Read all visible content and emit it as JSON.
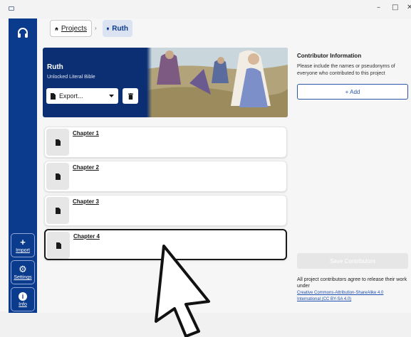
{
  "window": {
    "minimize_glyph": "–",
    "maximize_glyph": "□",
    "close_glyph": "✕"
  },
  "sidebar": {
    "logo_icon": "headphones-icon",
    "import": {
      "glyph": "+",
      "label": "Import"
    },
    "settings": {
      "glyph": "⚙",
      "label": "Settings"
    },
    "info": {
      "glyph": "i",
      "label": "Info"
    }
  },
  "breadcrumb": {
    "projects_label": "Projects",
    "separator": "›",
    "current_label": "Ruth"
  },
  "project": {
    "title": "Ruth",
    "subtitle": "Unlocked Literal Bible",
    "export_label": "Export..."
  },
  "chapters": [
    {
      "title": "Chapter 1",
      "selected": false
    },
    {
      "title": "Chapter 2",
      "selected": false
    },
    {
      "title": "Chapter 3",
      "selected": false
    },
    {
      "title": "Chapter 4",
      "selected": true
    }
  ],
  "contributors": {
    "title": "Contributor Information",
    "description": "Please include the names or pseudonyms of everyone who contributed to this project",
    "add_label": "+ Add",
    "save_label": "Save Contributors",
    "agreement": "All project contributors agree to release their work under",
    "license_link": "Creative Commons-Attribution-ShareAlike 4.0 International (CC BY-SA 4.0)"
  },
  "colors": {
    "sidebar": "#0b3b8c",
    "accent": "#2b56a8",
    "banner": "#0c2f73"
  }
}
